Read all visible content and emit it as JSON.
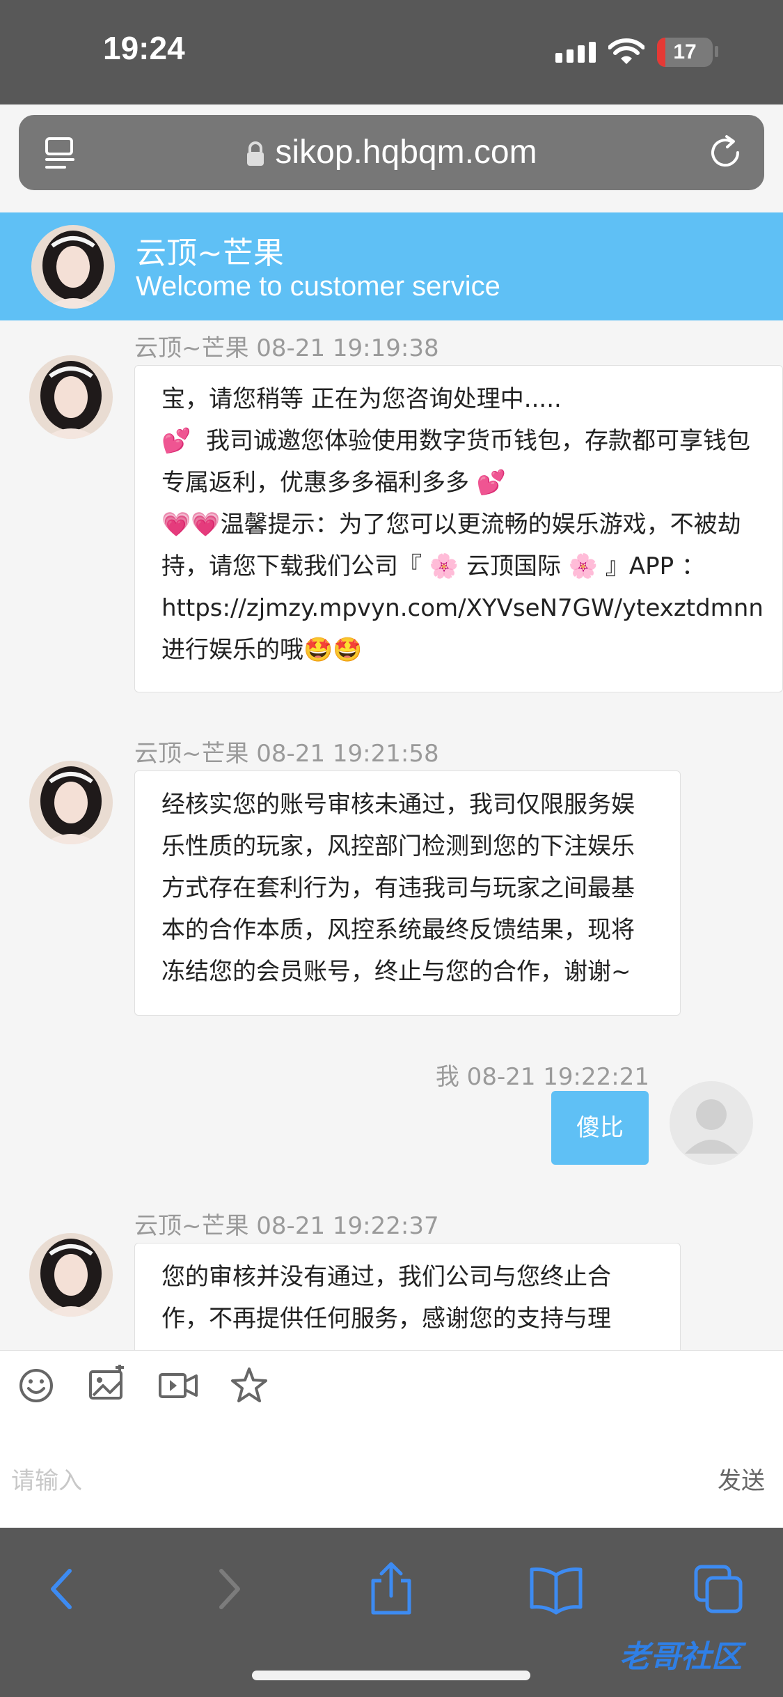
{
  "status": {
    "time": "19:24",
    "battery": "17"
  },
  "browser": {
    "url": "sikop.hqbqm.com"
  },
  "header": {
    "title": "云顶~芒果",
    "subtitle": "Welcome to customer service"
  },
  "messages": [
    {
      "meta": "云顶~芒果  08-21 19:19:38",
      "lines": [
        "宝，请您稍等 正在为您咨询处理中.....",
        "💕  我司诚邀您体验使用数字货币钱包，存款都可享钱包",
        "专属返利，优惠多多福利多多 💕",
        "💗💗温馨提示：为了您可以更流畅的娱乐游戏，不被劫",
        "持，请您下载我们公司『 🌸 云顶国际 🌸 』APP ：",
        "https://zjmzy.mpvyn.com/XYVseN7GW/ytexztdmnn",
        "进行娱乐的哦🤩🤩"
      ]
    },
    {
      "meta": "云顶~芒果  08-21 19:21:58",
      "lines": [
        "经核实您的账号审核未通过，我司仅限服务娱",
        "乐性质的玩家，风控部门检测到您的下注娱乐",
        "方式存在套利行为，有违我司与玩家之间最基",
        "本的合作本质，风控系统最终反馈结果，现将",
        "冻结您的会员账号，终止与您的合作，谢谢~"
      ]
    },
    {
      "meta": "我  08-21 19:22:21",
      "text": "傻比"
    },
    {
      "meta": "云顶~芒果  08-21 19:22:37",
      "lines": [
        "您的审核并没有通过，我们公司与您终止合",
        "作，不再提供任何服务，感谢您的支持与理"
      ]
    }
  ],
  "input": {
    "placeholder": "请输入",
    "send_label": "发送"
  },
  "toolbar_icons": [
    "emoji-icon",
    "image-icon",
    "video-icon",
    "star-icon"
  ],
  "colors": {
    "accent": "#5fc0f5",
    "chrome": "#585858",
    "link_blue": "#3d8bf2"
  },
  "watermark": "老哥社区"
}
